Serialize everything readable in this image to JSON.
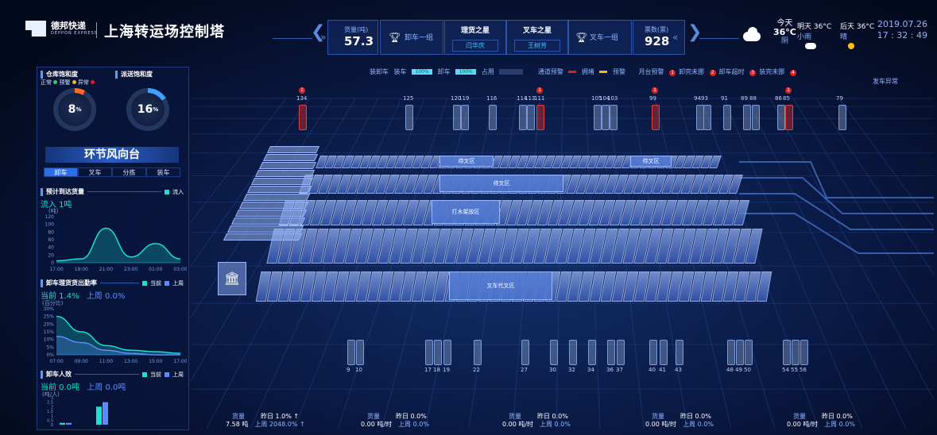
{
  "header": {
    "brand": "德邦快递",
    "brand_sub": "DEPPON EXPRESS",
    "title": "上海转运场控制塔",
    "goods_label": "货量(吨)",
    "goods_value": "57.3",
    "unload_group": "卸车一组",
    "star1_title": "理货之星",
    "star1_name": "闫华庆",
    "star2_title": "叉车之星",
    "star2_name": "王树芳",
    "fork_group": "叉车一组",
    "tickets_label": "票数(票)",
    "tickets_value": "928"
  },
  "weather": {
    "today_label": "今天",
    "today_temp": "36°C",
    "today_desc": "阴",
    "tomorrow_label": "明天 36°C",
    "tomorrow_desc": "小雨",
    "after_label": "后天 36°C",
    "after_desc": "晴",
    "date": "2019.07.26",
    "time": "17 : 32 : 49"
  },
  "left": {
    "sat1_label": "仓库饱和度",
    "sat2_label": "派送饱和度",
    "legend_normal": "正常",
    "legend_warn": "预警",
    "legend_abn": "异常",
    "gauge1": {
      "value": "8",
      "unit": "%",
      "fill": 0.08
    },
    "gauge2": {
      "value": "16",
      "unit": "%",
      "fill": 0.16
    },
    "banner": "环节风向台",
    "tabs": [
      "卸车",
      "叉车",
      "分拣",
      "装车"
    ],
    "chart1": {
      "title": "预计到达货量",
      "legend": "流入",
      "sub": "流入 1吨",
      "unit": "(吨)"
    },
    "chart2": {
      "title": "卸车理货货出勤率",
      "legend_a": "当前",
      "legend_b": "上周",
      "cur": "当前 1.4%",
      "prev": "上周 0.0%",
      "unit": "(百分比)"
    },
    "chart3": {
      "title": "卸车人效",
      "legend_a": "当前",
      "legend_b": "上周",
      "cur": "当前 0.0吨",
      "prev": "上周 0.0吨",
      "unit": "(吨/人)"
    }
  },
  "chart_data": [
    {
      "type": "area",
      "title": "预计到达货量",
      "ylabel": "(吨)",
      "x": [
        "17:00",
        "19:00",
        "21:00",
        "23:00",
        "01:00",
        "03:00"
      ],
      "yticks": [
        "0",
        "20",
        "40",
        "60",
        "80",
        "100",
        "120"
      ],
      "ylim": [
        0,
        120
      ],
      "series": [
        {
          "name": "流入",
          "values": [
            5,
            10,
            90,
            15,
            50,
            10
          ]
        }
      ]
    },
    {
      "type": "area",
      "title": "卸车理货货出勤率",
      "ylabel": "(百分比)",
      "x": [
        "07:00",
        "09:00",
        "11:00",
        "13:00",
        "15:00",
        "17:00"
      ],
      "yticks": [
        "0%",
        "5%",
        "10%",
        "15%",
        "20%",
        "25%",
        "30%"
      ],
      "ylim": [
        0,
        30
      ],
      "series": [
        {
          "name": "当前",
          "values": [
            25,
            15,
            6,
            3,
            2,
            1
          ]
        },
        {
          "name": "上周",
          "values": [
            12,
            8,
            3,
            1,
            0,
            0
          ]
        }
      ]
    },
    {
      "type": "bar",
      "title": "卸车人效",
      "ylabel": "(吨/人)",
      "yticks": [
        "0",
        "0.5",
        "1",
        "1.5",
        "2",
        "2.5",
        "3"
      ],
      "ylim": [
        0,
        3
      ],
      "series": [
        {
          "name": "当前",
          "values": [
            0.2,
            2.0
          ]
        },
        {
          "name": "上周",
          "values": [
            0.2,
            2.5
          ]
        }
      ]
    }
  ],
  "stage": {
    "legend": {
      "a": "装卸车",
      "b": "装车",
      "p1": "100%",
      "c": "卸车",
      "p2": "100%",
      "d": "占用",
      "e": "通道预警",
      "f": "拥堵",
      "g": "预警",
      "h": "月台预警",
      "w1": "卸完未挪",
      "w2": "卸车超时",
      "w3": "装完未挪",
      "w4": "发车异常"
    },
    "top_doors": [
      "134",
      "125",
      "120",
      "119",
      "116",
      "114",
      "113",
      "111",
      "105",
      "104",
      "103",
      "99",
      "94",
      "93",
      "91",
      "89",
      "88",
      "86",
      "85",
      "79"
    ],
    "bottom_doors": [
      "9",
      "10",
      "17",
      "18",
      "19",
      "22",
      "27",
      "30",
      "32",
      "34",
      "36",
      "37",
      "40",
      "41",
      "43",
      "48",
      "49",
      "50",
      "54",
      "55",
      "56"
    ],
    "zones": [
      "待叉区",
      "待叉区",
      "待叉区",
      "打木架放区",
      "叉车代叉区"
    ],
    "stats": [
      {
        "label": "货量",
        "value": "7.58 吨",
        "yd": "昨日 1.0% ↑",
        "lw": "上周 2048.0% ↑"
      },
      {
        "label": "货量",
        "value": "0.00 吨/时",
        "yd": "昨日 0.0%",
        "lw": "上周 0.0%"
      },
      {
        "label": "货量",
        "value": "0.00 吨/时",
        "yd": "昨日 0.0%",
        "lw": "上周 0.0%"
      },
      {
        "label": "货量",
        "value": "0.00 吨/时",
        "yd": "昨日 0.0%",
        "lw": "上周 0.0%"
      },
      {
        "label": "货量",
        "value": "0.00 吨/时",
        "yd": "昨日 0.0%",
        "lw": "上周 0.0%"
      }
    ]
  }
}
